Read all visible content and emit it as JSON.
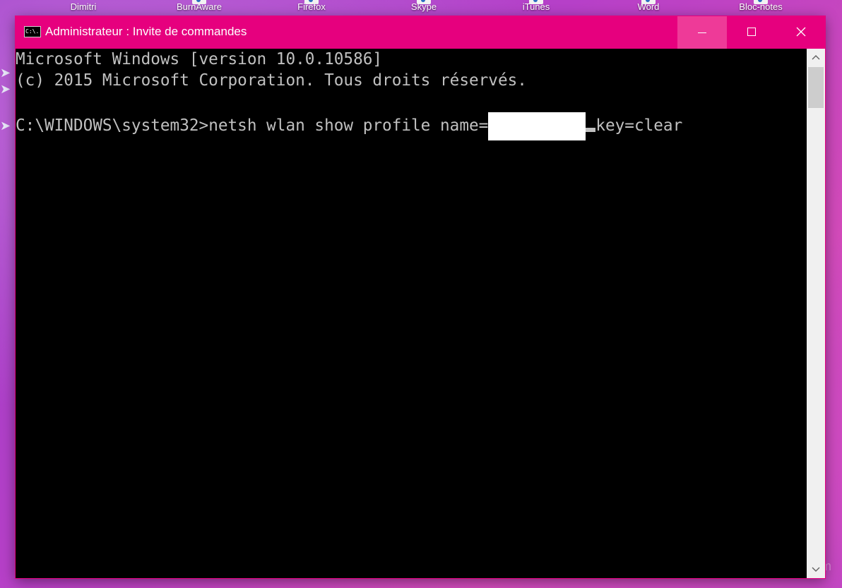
{
  "desktop": {
    "icons": [
      {
        "label": "Dimitri"
      },
      {
        "label": "BurnAware"
      },
      {
        "label": "Firefox"
      },
      {
        "label": "Skype"
      },
      {
        "label": "iTunes"
      },
      {
        "label": "Word"
      },
      {
        "label": "Bloc-notes"
      }
    ],
    "watermark": "Tom"
  },
  "window": {
    "title": "Administrateur : Invite de commandes",
    "icon_text": "C:\\.",
    "accent_color": "#e6007e"
  },
  "console": {
    "lines": [
      "Microsoft Windows [version 10.0.10586]",
      "(c) 2015 Microsoft Corporation. Tous droits réservés.",
      ""
    ],
    "prompt": "C:\\WINDOWS\\system32>",
    "command_before": "netsh wlan show profile name=",
    "command_after": "key=clear"
  },
  "icons": {
    "minimize": "minimize-icon",
    "maximize": "maximize-icon",
    "close": "close-icon"
  }
}
